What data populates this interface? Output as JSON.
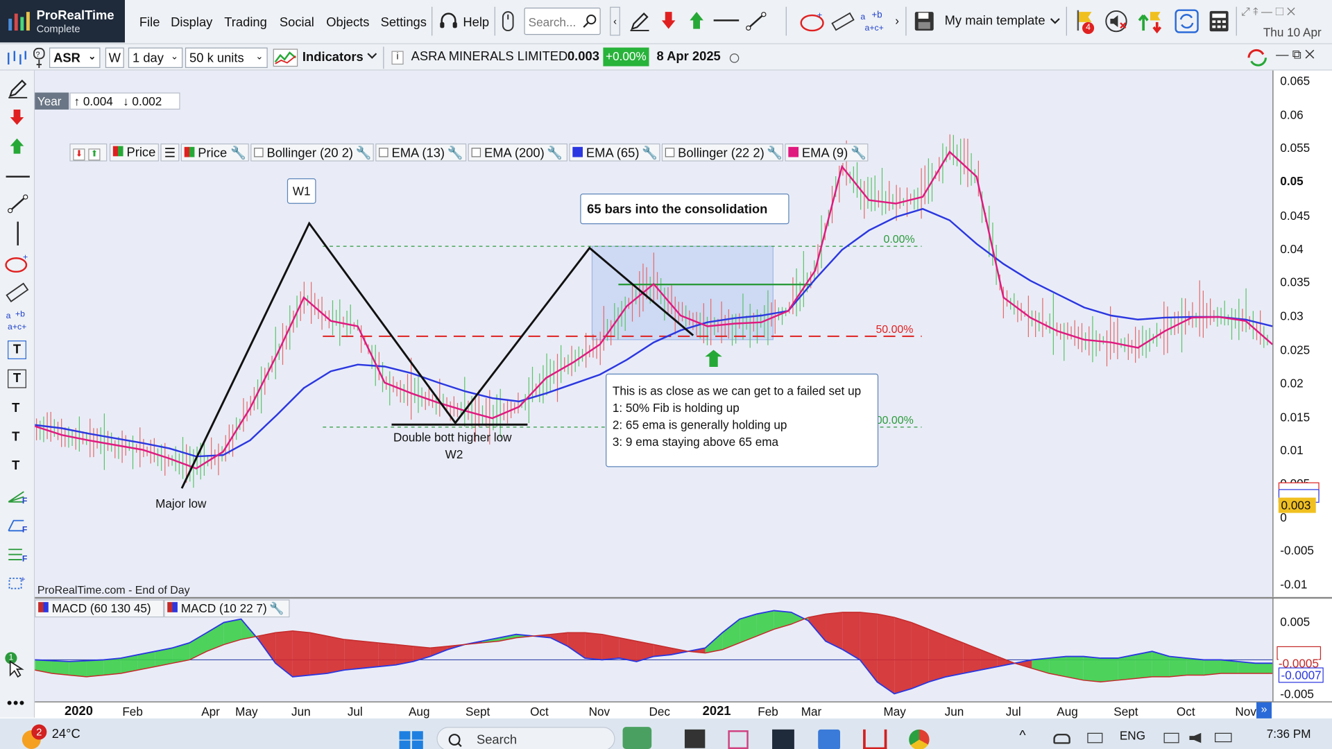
{
  "app": {
    "name": "ProRealTime",
    "edition": "Complete"
  },
  "menu": [
    "File",
    "Display",
    "Trading",
    "Social",
    "Objects",
    "Settings"
  ],
  "help_label": "Help",
  "search": {
    "placeholder": "Search..."
  },
  "template": "My main template",
  "notif_count": "4",
  "datetime": "Thu 10 Apr",
  "toolbar2": {
    "symbol": "ASR",
    "period_code": "W",
    "period": "1 day",
    "units": "50 k units",
    "indicators": "Indicators",
    "instrument": "ASRA MINERALS LIMITED",
    "price": "0.003",
    "change": "+0.00%",
    "date": "8 Apr 2025"
  },
  "legend": {
    "price1": "Price",
    "price2": "Price",
    "items": [
      "Bollinger (20 2)",
      "EMA (13)",
      "EMA (200)",
      "EMA (65)",
      "Bollinger (22 2)",
      "EMA (9)"
    ],
    "ema65_color": "#2b37e0",
    "ema9_color": "#e0197f",
    "scope": "Year",
    "up": "0.004",
    "down": "0.002"
  },
  "annotations": {
    "w1": "W1",
    "consolidation": "65 bars into the consolidation",
    "major_low": "Major low",
    "double_bottom": "Double bott higher low",
    "w2": "W2",
    "fib0": "0.00%",
    "fib50": "50.00%",
    "fib100": "100.00%",
    "note_lines": [
      "This is as close as we can get to a failed set up",
      "1: 50% Fib is holding up",
      "2: 65 ema is generally holding up",
      "3: 9 ema staying above 65 ema"
    ],
    "source": "ProRealTime.com - End of Day"
  },
  "y_axis": [
    "0.065",
    "0.06",
    "0.055",
    "0.05",
    "0.045",
    "0.04",
    "0.035",
    "0.03",
    "0.025",
    "0.02",
    "0.015",
    "0.01",
    "0.005",
    "0",
    "-0.005",
    "-0.01"
  ],
  "price_tag": "0.003",
  "macd": {
    "legend": [
      "MACD (60 130 45)",
      "MACD (10 22 7)"
    ],
    "y_axis": [
      "0.005",
      "-0.005"
    ],
    "tags": [
      "-0.0005",
      "-0.0007"
    ]
  },
  "x_axis": [
    "2020",
    "Feb",
    "Apr",
    "May",
    "Jun",
    "Jul",
    "Aug",
    "Sept",
    "Oct",
    "Nov",
    "Dec",
    "2021",
    "Feb",
    "Mar",
    "May",
    "Jun",
    "Jul",
    "Aug",
    "Sept",
    "Oct",
    "Nov"
  ],
  "taskbar": {
    "weather_badge": "2",
    "temp": "24°C",
    "search": "Search",
    "lang": "ENG",
    "time": "7:36 PM"
  },
  "chart_data": {
    "type": "line",
    "ema65": [
      0.0135,
      0.013,
      0.0122,
      0.0115,
      0.0108,
      0.01,
      0.0088,
      0.009,
      0.0112,
      0.015,
      0.019,
      0.0215,
      0.0225,
      0.0222,
      0.0212,
      0.0198,
      0.0185,
      0.0175,
      0.017,
      0.0182,
      0.0196,
      0.021,
      0.0232,
      0.0258,
      0.0276,
      0.0288,
      0.0294,
      0.0298,
      0.0305,
      0.0352,
      0.0396,
      0.0425,
      0.0445,
      0.0457,
      0.044,
      0.0405,
      0.0375,
      0.035,
      0.033,
      0.031,
      0.0298,
      0.0292,
      0.0295,
      0.0296,
      0.0296,
      0.0292,
      0.0282
    ],
    "ema9": [
      0.0133,
      0.012,
      0.0112,
      0.0105,
      0.0098,
      0.0085,
      0.007,
      0.0095,
      0.016,
      0.024,
      0.0325,
      0.029,
      0.0282,
      0.0198,
      0.0182,
      0.0168,
      0.0156,
      0.0145,
      0.0162,
      0.0205,
      0.0228,
      0.0255,
      0.0312,
      0.0345,
      0.0298,
      0.0282,
      0.0286,
      0.0288,
      0.0305,
      0.0365,
      0.052,
      0.047,
      0.0465,
      0.0475,
      0.0542,
      0.0505,
      0.0325,
      0.0295,
      0.0275,
      0.0262,
      0.0258,
      0.025,
      0.0275,
      0.0295,
      0.0296,
      0.029,
      0.0255
    ],
    "fib_levels": [
      {
        "label": "0.00%",
        "value": 0.0403
      },
      {
        "label": "50.00%",
        "value": 0.0268
      },
      {
        "label": "100.00%",
        "value": 0.0133
      }
    ]
  }
}
